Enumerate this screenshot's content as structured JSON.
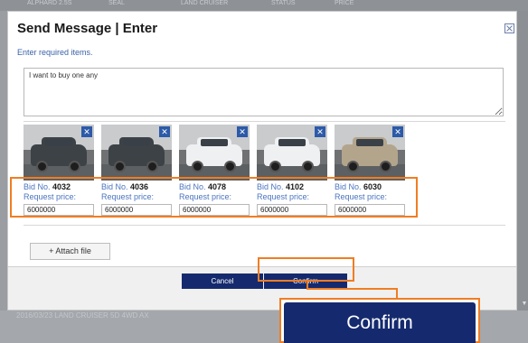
{
  "background": {
    "top_strip_texts": [
      "ALPHARD 2.5S",
      "SEAL",
      "LAND CRUISER",
      "STATUS",
      "PRICE"
    ],
    "bottom_strip_text": "2016/03/23    LAND CRUISER 5D 4WD  AX"
  },
  "modal": {
    "title": "Send Message | Enter",
    "instruction": "Enter required items.",
    "message": "I want to buy one any",
    "attach_label": "+ Attach file",
    "cancel_label": "Cancel",
    "confirm_label": "Confirm"
  },
  "cars": [
    {
      "bid_prefix": "Bid No.",
      "bid_no": "4032",
      "request_label": "Request price:",
      "price": "6000000",
      "color": "#3d4246"
    },
    {
      "bid_prefix": "Bid No.",
      "bid_no": "4036",
      "request_label": "Request price:",
      "price": "6000000",
      "color": "#3d4246"
    },
    {
      "bid_prefix": "Bid No.",
      "bid_no": "4078",
      "request_label": "Request price:",
      "price": "6000000",
      "color": "#eef0f1"
    },
    {
      "bid_prefix": "Bid No.",
      "bid_no": "4102",
      "request_label": "Request price:",
      "price": "6000000",
      "color": "#eef0f1"
    },
    {
      "bid_prefix": "Bid No.",
      "bid_no": "6030",
      "request_label": "Request price:",
      "price": "6000000",
      "color": "#b3a58c"
    }
  ],
  "zoom_callout": {
    "label": "Confirm"
  },
  "colors": {
    "accent": "#152a6e",
    "highlight": "#f07d22",
    "link": "#4a74c0"
  }
}
